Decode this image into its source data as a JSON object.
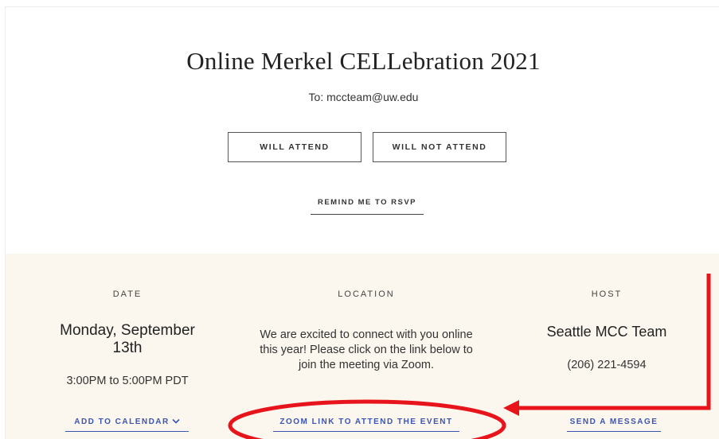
{
  "event": {
    "title": "Online Merkel CELLebration 2021",
    "to_line": "To: mccteam@uw.edu"
  },
  "rsvp": {
    "attend_label": "WILL ATTEND",
    "decline_label": "WILL NOT ATTEND",
    "remind_label": "REMIND ME TO RSVP"
  },
  "details": {
    "date": {
      "heading": "DATE",
      "day": "Monday, September 13th",
      "time": "3:00PM to 5:00PM PDT",
      "calendar_link": "ADD TO CALENDAR"
    },
    "location": {
      "heading": "LOCATION",
      "text": "We are excited to connect with you online this year! Please click on the link below to join the meeting via Zoom.",
      "zoom_link": "ZOOM LINK TO ATTEND THE EVENT"
    },
    "host": {
      "heading": "HOST",
      "name": "Seattle MCC Team",
      "phone": "(206) 221-4594",
      "message_link": "SEND A MESSAGE"
    }
  },
  "annotation": {
    "color": "#e8141c"
  },
  "colors": {
    "link": "#3c55b0",
    "details_background": "#fbf6ee"
  }
}
